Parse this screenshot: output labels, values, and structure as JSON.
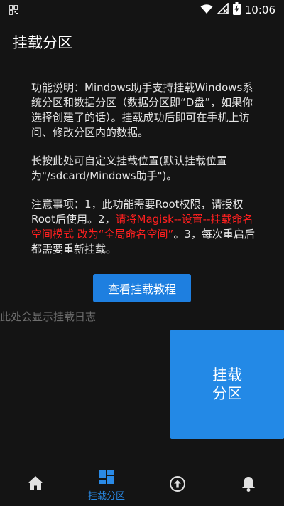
{
  "status_bar": {
    "time": "10:06"
  },
  "page": {
    "title": "挂载分区"
  },
  "description": {
    "para1": "功能说明：Mindows助手支持挂载Windows系统分区和数据分区（数据分区即“D盘”，如果你选择创建了的话）。挂载成功后即可在手机上访问、修改分区内的数据。",
    "para2": "长按此处可自定义挂载位置(默认挂载位置为\"/sdcard/Mindows助手\")。",
    "para3_before": "注意事项：1，此功能需要Root权限，请授权Root后使用。2，",
    "para3_warning": "请将Magisk--设置--挂载命名空间模式 改为“全局命名空间”",
    "para3_after": "。3，每次重启后都需要重新挂载。"
  },
  "buttons": {
    "tutorial": "查看挂载教程",
    "mount_line1": "挂载",
    "mount_line2": "分区"
  },
  "log": {
    "placeholder": "此处会显示挂载日志"
  },
  "bottom_nav": {
    "active_index": 1,
    "items": [
      {
        "icon": "home-icon",
        "label": ""
      },
      {
        "icon": "dashboard-icon",
        "label": "挂载分区"
      },
      {
        "icon": "upload-circle-icon",
        "label": ""
      },
      {
        "icon": "bell-icon",
        "label": ""
      }
    ]
  },
  "colors": {
    "background": "#141414",
    "accent": "#2389e6",
    "warning_text": "#ff1f1f",
    "log_text": "#6d6d6d"
  }
}
